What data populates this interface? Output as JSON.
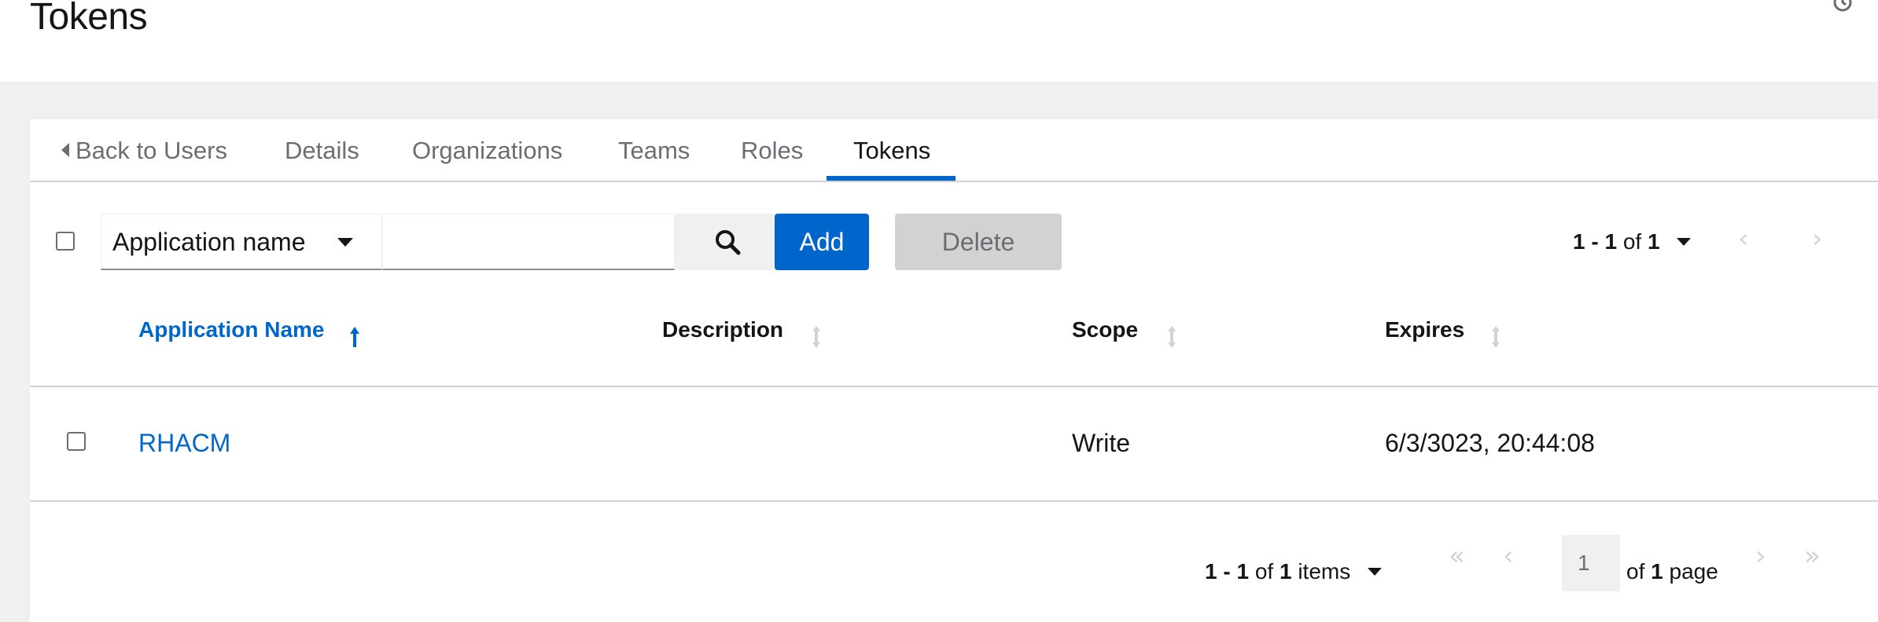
{
  "page": {
    "title": "Tokens"
  },
  "tabs": [
    {
      "label": "Back to Users"
    },
    {
      "label": "Details"
    },
    {
      "label": "Organizations"
    },
    {
      "label": "Teams"
    },
    {
      "label": "Roles"
    },
    {
      "label": "Tokens",
      "active": true
    }
  ],
  "toolbar": {
    "filter_label": "Application name",
    "search_value": "",
    "add_label": "Add",
    "delete_label": "Delete",
    "pagination": {
      "range": "1 - 1",
      "of": "of",
      "total": "1"
    }
  },
  "table": {
    "columns": [
      {
        "label": "Application Name",
        "sorted": "ascending"
      },
      {
        "label": "Description"
      },
      {
        "label": "Scope"
      },
      {
        "label": "Expires"
      }
    ],
    "rows": [
      {
        "application_name": "RHACM",
        "description": "",
        "scope": "Write",
        "expires": "6/3/3023, 20:44:08"
      }
    ]
  },
  "footer_pagination": {
    "range": "1 - 1",
    "of": "of",
    "total": "1",
    "items_label": "items",
    "current_page": "1",
    "of_page_prefix": "of",
    "total_pages": "1",
    "page_label": "page"
  },
  "colors": {
    "accent": "#0066cc",
    "text": "#151515",
    "muted": "#6a6e73",
    "border": "#d2d2d2",
    "background": "#f0f0f0"
  },
  "icons": [
    "history-icon",
    "caret-left-icon",
    "caret-down-icon",
    "search-icon",
    "sort-ascending-icon",
    "sort-icon",
    "chevron-left-icon",
    "chevron-right-icon",
    "double-chevron-left-icon",
    "double-chevron-right-icon"
  ]
}
